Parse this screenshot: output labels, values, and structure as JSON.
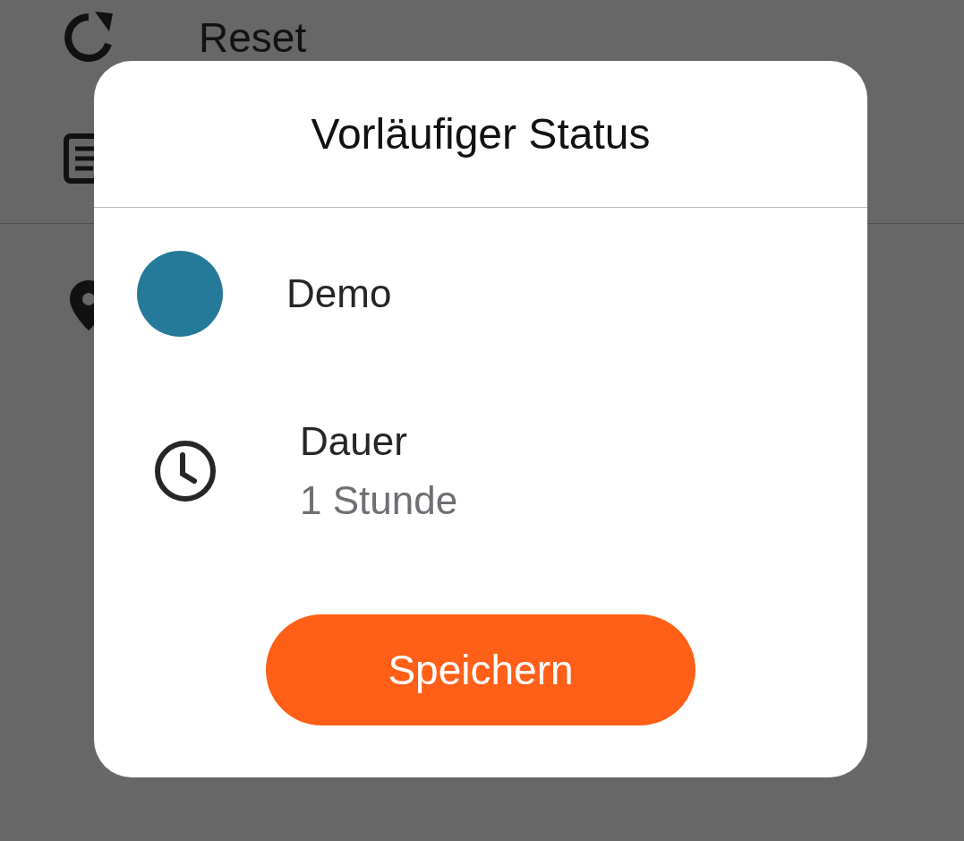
{
  "background_list": [
    {
      "kind": "reset",
      "label": "Reset"
    },
    {
      "kind": "document"
    },
    {
      "kind": "location"
    }
  ],
  "dialog": {
    "title": "Vorläufiger Status",
    "status": {
      "label": "Demo",
      "color": "#267a99"
    },
    "duration": {
      "label": "Dauer",
      "value": "1 Stunde"
    },
    "button": "Speichern"
  }
}
